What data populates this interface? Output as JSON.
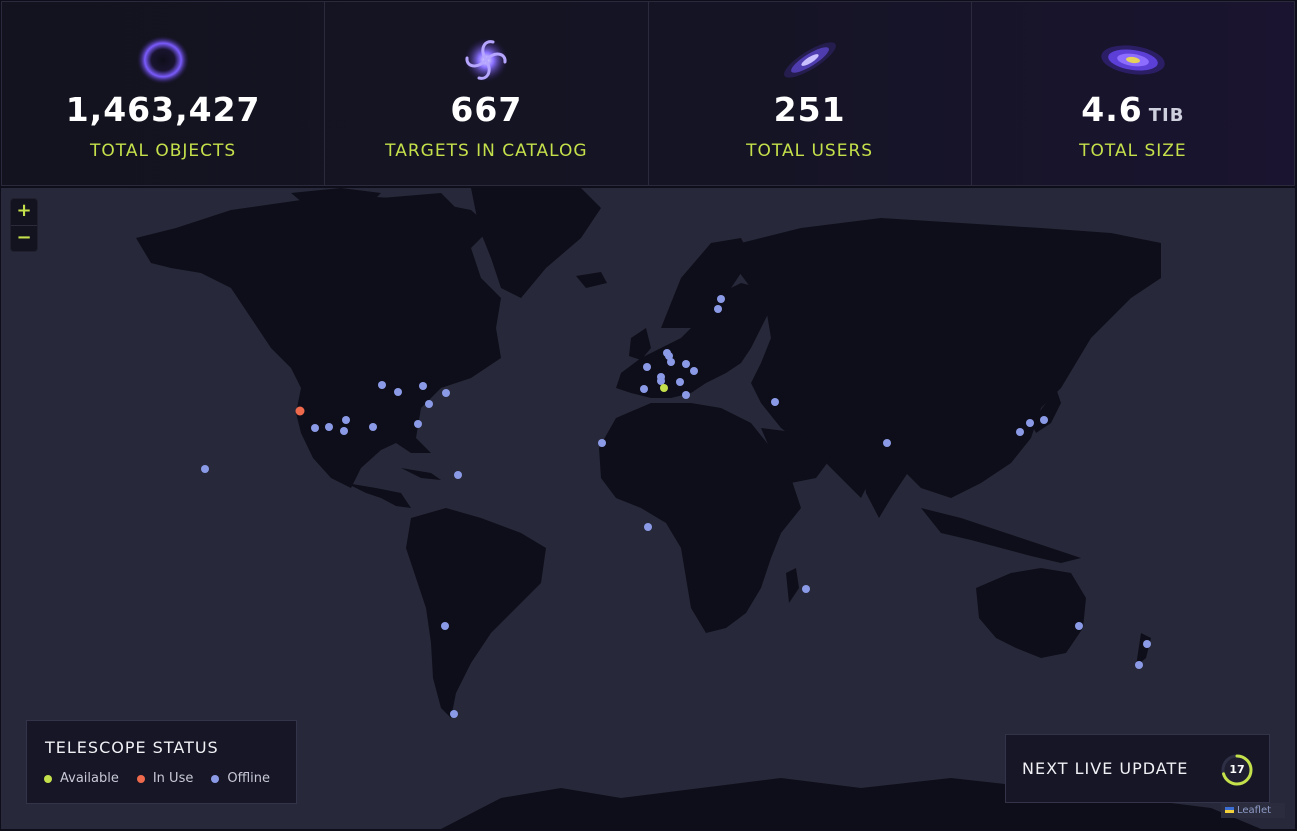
{
  "stats": [
    {
      "value": "1,463,427",
      "unit": "",
      "label": "TOTAL OBJECTS",
      "icon": "ring-galaxy-icon"
    },
    {
      "value": "667",
      "unit": "",
      "label": "TARGETS IN CATALOG",
      "icon": "spiral-galaxy-icon"
    },
    {
      "value": "251",
      "unit": "",
      "label": "TOTAL USERS",
      "icon": "edge-on-galaxy-icon"
    },
    {
      "value": "4.6",
      "unit": "TIB",
      "label": "TOTAL SIZE",
      "icon": "elliptical-galaxy-icon"
    }
  ],
  "zoom": {
    "in": "+",
    "out": "−"
  },
  "legend": {
    "title": "TELESCOPE STATUS",
    "items": [
      {
        "label": "Available",
        "color": "#c4e04a"
      },
      {
        "label": "In Use",
        "color": "#ef6a4c"
      },
      {
        "label": "Offline",
        "color": "#8b9ae6"
      }
    ]
  },
  "update": {
    "label": "NEXT LIVE UPDATE",
    "countdown": "17"
  },
  "attribution": "Leaflet",
  "colors": {
    "accent": "#c4e04a",
    "available": "#c4e04a",
    "in_use": "#ef6a4c",
    "offline": "#8b9ae6"
  }
}
